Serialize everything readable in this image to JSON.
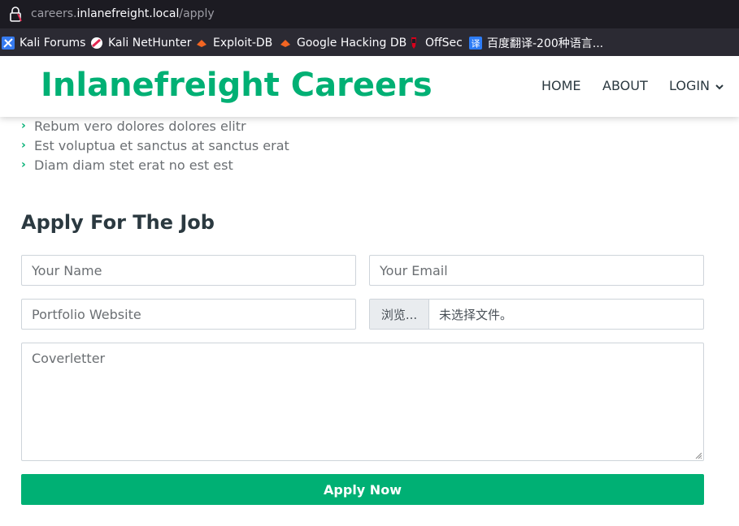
{
  "browser": {
    "url_prefix": "careers.",
    "url_domain": "inlanefreight.local",
    "url_path": "/apply",
    "bookmarks": [
      {
        "label": "Kali Forums",
        "icon": "kali-forums-icon"
      },
      {
        "label": "Kali NetHunter",
        "icon": "kali-nethunter-icon"
      },
      {
        "label": "Exploit-DB",
        "icon": "exploit-db-icon"
      },
      {
        "label": "Google Hacking DB",
        "icon": "ghdb-icon"
      },
      {
        "label": "OffSec",
        "icon": "offsec-icon"
      },
      {
        "label": "百度翻译-200种语言...",
        "icon": "baidu-translate-icon"
      }
    ]
  },
  "navbar": {
    "brand": "Inlanefreight Careers",
    "links": [
      "HOME",
      "ABOUT",
      "LOGIN"
    ],
    "brand_color": "#00b074"
  },
  "bullets": [
    "Rebum vero dolores dolores elitr",
    "Est voluptua et sanctus at sanctus erat",
    "Diam diam stet erat no est est"
  ],
  "form": {
    "title": "Apply For The Job",
    "name_placeholder": "Your Name",
    "email_placeholder": "Your Email",
    "portfolio_placeholder": "Portfolio Website",
    "file_browse_label": "浏览...",
    "file_status": "未选择文件。",
    "coverletter_placeholder": "Coverletter",
    "submit_label": "Apply Now"
  }
}
